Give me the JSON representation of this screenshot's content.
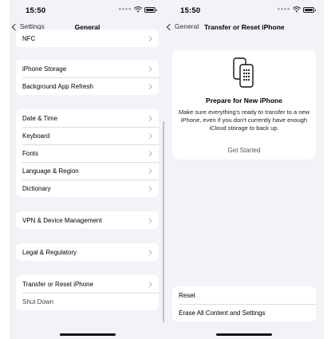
{
  "left": {
    "status": {
      "time": "15:50"
    },
    "nav": {
      "back_label": "Settings",
      "title": "General"
    },
    "partial_row": "NFC",
    "group1": [
      "iPhone Storage",
      "Background App Refresh"
    ],
    "group2": [
      "Date & Time",
      "Keyboard",
      "Fonts",
      "Language & Region",
      "Dictionary"
    ],
    "group3": [
      "VPN & Device Management"
    ],
    "group4": [
      "Legal & Regulatory"
    ],
    "group5": {
      "transfer": "Transfer or Reset iPhone",
      "shutdown": "Shut Down"
    }
  },
  "right": {
    "status": {
      "time": "15:50"
    },
    "nav": {
      "back_label": "General",
      "title": "Transfer or Reset iPhone"
    },
    "card": {
      "icon": "two-phones-icon",
      "title": "Prepare for New iPhone",
      "description": "Make sure everything's ready to transfer to a new iPhone, even if you don't currently have enough iCloud storage to back up.",
      "button": "Get Started"
    },
    "actions": [
      "Reset",
      "Erase All Content and Settings"
    ]
  }
}
